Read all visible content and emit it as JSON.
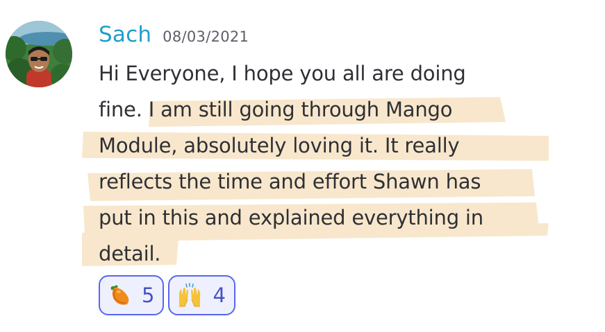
{
  "message": {
    "author": "Sach",
    "timestamp": "08/03/2021",
    "text_lines": [
      "Hi Everyone, I hope you all are doing",
      "fine. I am still going through Mango",
      "Module, absolutely loving it. It really",
      "reflects the time and effort Shawn has",
      "put in this and explained everything in",
      "detail."
    ]
  },
  "reactions": [
    {
      "icon": "mango-emoji-icon",
      "count": "5"
    },
    {
      "icon": "raising-hands-emoji-icon",
      "count": "4"
    }
  ],
  "colors": {
    "username": "#1f9ec9",
    "highlight": "#f7e3c4",
    "reaction_border": "#5865f2",
    "reaction_bg": "#eef0fd"
  }
}
